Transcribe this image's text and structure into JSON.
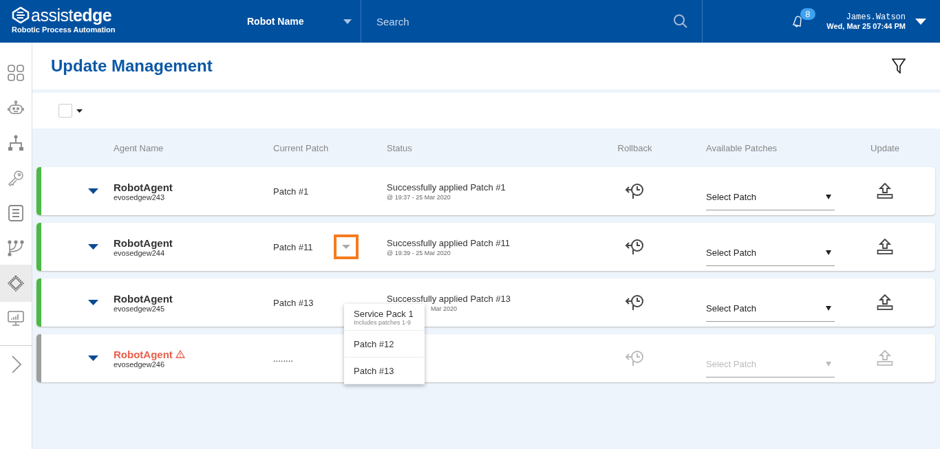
{
  "header": {
    "logo_word_light": "assist",
    "logo_word_bold": "edge",
    "tagline": "Robotic Process Automation",
    "robot_select": "Robot Name",
    "search": {
      "placeholder": "Search"
    },
    "notifications": "8",
    "user": "James.Watson",
    "datetime": "Wed, Mar 25 07:44 PM"
  },
  "sidebar": {
    "items": [
      {
        "kind": "grid",
        "selected": false
      },
      {
        "kind": "robot",
        "selected": false
      },
      {
        "kind": "hierarchy",
        "selected": false
      },
      {
        "kind": "key",
        "selected": false
      },
      {
        "kind": "list",
        "selected": false
      },
      {
        "kind": "branch",
        "selected": false
      },
      {
        "kind": "chip",
        "selected": true
      },
      {
        "kind": "monitor",
        "selected": false
      }
    ]
  },
  "page": {
    "title": "Update Management"
  },
  "table": {
    "select_all": {
      "checked": false
    },
    "columns": [
      "Agent Name",
      "Current Patch",
      "Status",
      "Rollback",
      "Available Patches",
      "Update"
    ],
    "rows": [
      {
        "name": "RobotAgent",
        "host": "evosedgew243",
        "warning": false,
        "color": "#4cb944",
        "patch": "Patch #1",
        "patch_toggle": false,
        "status": "Successfully applied Patch #1",
        "timestamp": "@ 19:37 - 25 Mar 2020",
        "disabled": false,
        "select": "Select Patch"
      },
      {
        "name": "RobotAgent",
        "host": "evosedgew244",
        "warning": false,
        "color": "#4cb944",
        "patch": "Patch #11",
        "patch_toggle": true,
        "status": "Successfully applied Patch #11",
        "timestamp": "@ 19:39 - 25 Mar 2020",
        "disabled": false,
        "select": "Select Patch"
      },
      {
        "name": "RobotAgent",
        "host": "evosedgew245",
        "warning": false,
        "color": "#4cb944",
        "patch": "Patch #13",
        "patch_toggle": false,
        "status": "Successfully applied Patch #13",
        "timestamp": "Mar 2020",
        "disabled": false,
        "select": "Select Patch"
      },
      {
        "name": "RobotAgent",
        "host": "evosedgew246",
        "warning": true,
        "color": "#9e9e9e",
        "patch": "........",
        "patch_toggle": false,
        "disabled": true,
        "select": "Select Patch"
      }
    ]
  },
  "patch_menu": {
    "items": [
      {
        "label": "Service Pack 1",
        "note": "Includes patches 1-9"
      },
      {
        "label": "Patch #12"
      },
      {
        "label": "Patch #13"
      }
    ]
  }
}
